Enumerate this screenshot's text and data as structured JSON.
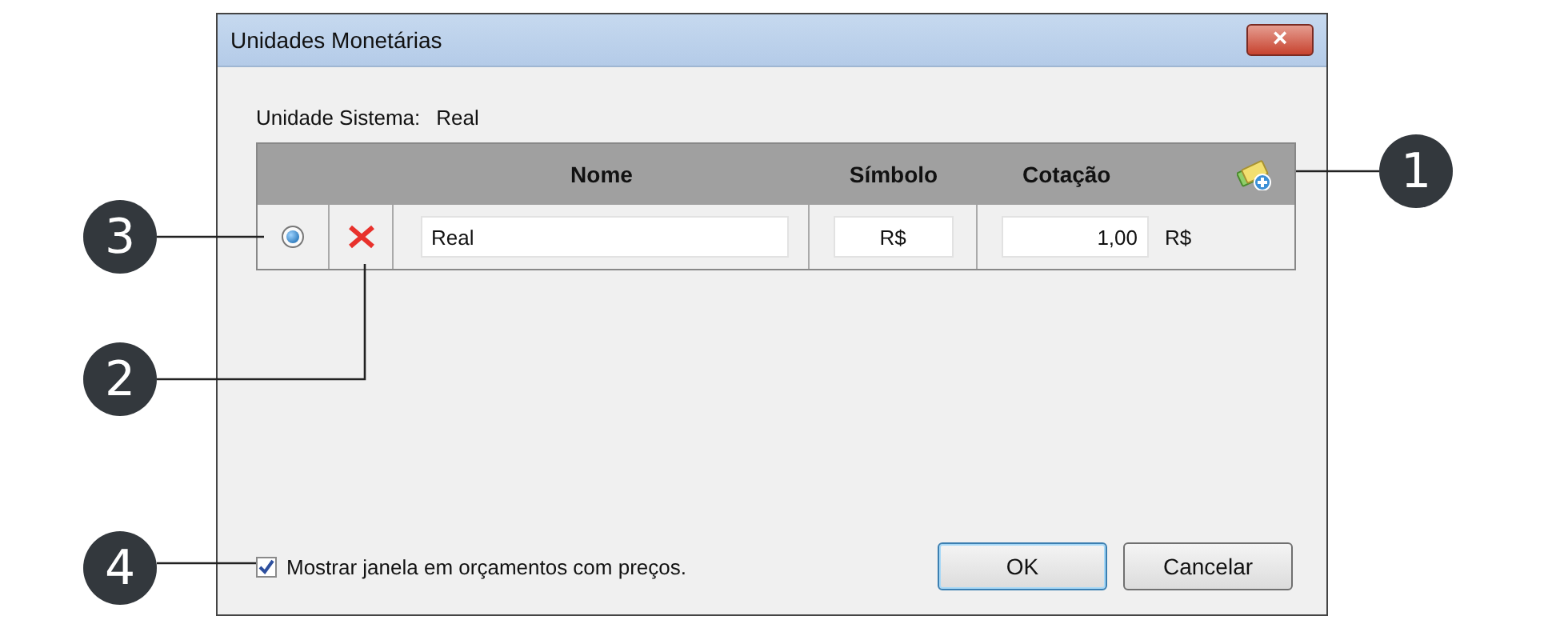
{
  "window": {
    "title": "Unidades Monetárias",
    "close": "×"
  },
  "system_unit": {
    "label": "Unidade Sistema:",
    "value": "Real"
  },
  "table": {
    "columns": [
      "Nome",
      "Símbolo",
      "Cotação"
    ],
    "rows": [
      {
        "selected": true,
        "name": "Real",
        "symbol": "R$",
        "rate": "1,00",
        "rate_unit": "R$"
      }
    ]
  },
  "option": {
    "label": "Mostrar janela em orçamentos com preços.",
    "checked": true
  },
  "buttons": [
    {
      "label": "OK",
      "default": true
    },
    {
      "label": "Cancelar",
      "default": false
    }
  ],
  "callouts": [
    "1",
    "3",
    "2",
    "4"
  ]
}
